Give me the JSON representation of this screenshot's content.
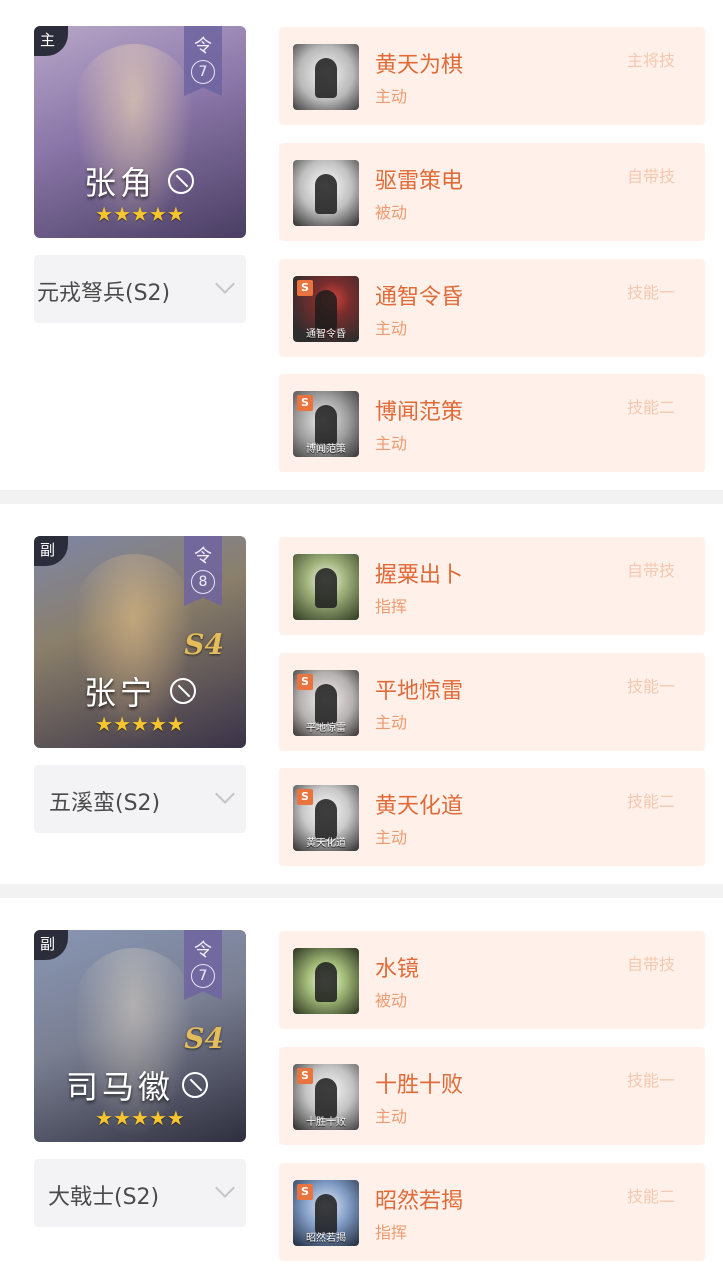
{
  "groups": [
    {
      "role": "主",
      "ling": "令",
      "ling_level": "7",
      "season": "",
      "hero_name": "张角",
      "stars": "★★★★★",
      "troop": "元戎弩兵(S2)",
      "skills": [
        {
          "name": "黄天为棋",
          "type": "主动",
          "slot": "主将技",
          "caption": ""
        },
        {
          "name": "驱雷策电",
          "type": "被动",
          "slot": "自带技",
          "caption": ""
        },
        {
          "name": "通智令昏",
          "type": "主动",
          "slot": "技能一",
          "caption": "通智令昏",
          "badge": "S"
        },
        {
          "name": "博闻范策",
          "type": "主动",
          "slot": "技能二",
          "caption": "博闻范策",
          "badge": "S"
        }
      ]
    },
    {
      "role": "副",
      "ling": "令",
      "ling_level": "8",
      "season": "S4",
      "hero_name": "张宁",
      "stars": "★★★★★",
      "troop": "五溪蛮(S2)",
      "skills": [
        {
          "name": "握粟出卜",
          "type": "指挥",
          "slot": "自带技",
          "caption": ""
        },
        {
          "name": "平地惊雷",
          "type": "主动",
          "slot": "技能一",
          "caption": "平地惊雷",
          "badge": "S"
        },
        {
          "name": "黄天化道",
          "type": "主动",
          "slot": "技能二",
          "caption": "黄天化道",
          "badge": "S"
        }
      ]
    },
    {
      "role": "副",
      "ling": "令",
      "ling_level": "7",
      "season": "S4",
      "hero_name": "司马徽",
      "stars": "★★★★★",
      "troop": "大戟士(S2)",
      "skills": [
        {
          "name": "水镜",
          "type": "被动",
          "slot": "自带技",
          "caption": ""
        },
        {
          "name": "十胜十败",
          "type": "主动",
          "slot": "技能一",
          "caption": "十胜十败",
          "badge": "S"
        },
        {
          "name": "昭然若揭",
          "type": "指挥",
          "slot": "技能二",
          "caption": "昭然若揭",
          "badge": "S"
        }
      ]
    }
  ]
}
